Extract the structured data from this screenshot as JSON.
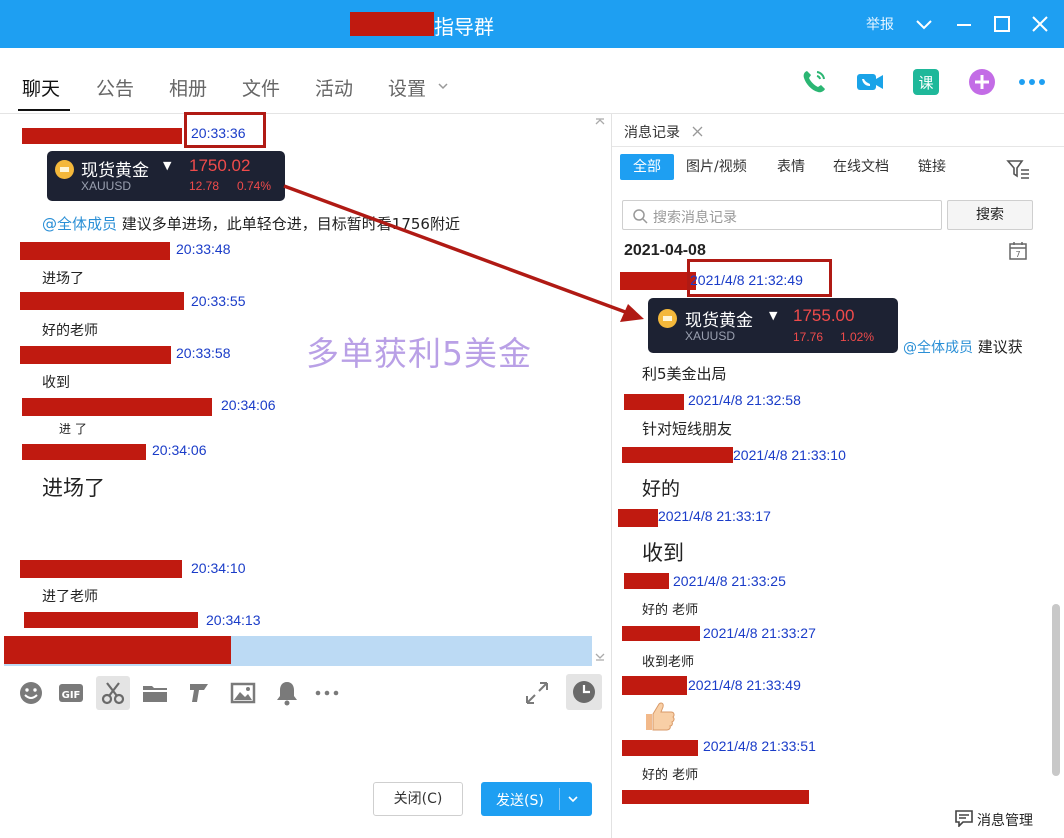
{
  "window": {
    "title": "指导群",
    "report_label": "举报"
  },
  "tabs": [
    {
      "label": "聊天"
    },
    {
      "label": "公告"
    },
    {
      "label": "相册"
    },
    {
      "label": "文件"
    },
    {
      "label": "活动"
    },
    {
      "label": "设置"
    }
  ],
  "colors": {
    "titlebar": "#1e9ff2",
    "redaction": "#c01a10",
    "timestamp": "#1a3cc8",
    "mention": "#2a8fd6",
    "card_bg": "#1d2233",
    "price_up": "#ef4b4b"
  },
  "chat": {
    "watermark": "多单获利5美金",
    "gold_card": {
      "name": "现货黄金",
      "symbol": "XAUUSD",
      "price": "1750.02",
      "change": "12.78",
      "percent": "0.74%"
    },
    "mention": "@全体成员",
    "mention_text": "建议多单进场，此单轻仓进，目标暂时看1756附近",
    "messages": [
      {
        "time": "20:33:36"
      },
      {
        "time": "20:33:48",
        "text": "进场了"
      },
      {
        "time": "20:33:55",
        "text": "好的老师"
      },
      {
        "time": "20:33:58",
        "text": "收到"
      },
      {
        "time": "20:34:06",
        "text": "进 了"
      },
      {
        "time": "20:34:06",
        "text": "进场了"
      },
      {
        "time": "20:34:10",
        "text": "进了老师"
      },
      {
        "time": "20:34:13"
      }
    ]
  },
  "input": {
    "close_label": "关闭(C)",
    "send_label": "发送(S)"
  },
  "history": {
    "tab_label": "消息记录",
    "filters": [
      "全部",
      "图片/视频",
      "表情",
      "在线文档",
      "链接"
    ],
    "search_placeholder": "搜索消息记录",
    "search_button": "搜索",
    "date": "2021-04-08",
    "gold_card": {
      "name": "现货黄金",
      "symbol": "XAUUSD",
      "price": "1755.00",
      "change": "17.76",
      "percent": "1.02%"
    },
    "mention": "@全体成员",
    "mention_text": "建议获",
    "mention_text_cont": "利5美金出局",
    "messages": [
      {
        "time": "2021/4/8 21:32:49"
      },
      {
        "time": "2021/4/8 21:32:58",
        "text": "针对短线朋友"
      },
      {
        "time": "2021/4/8 21:33:10",
        "text": "好的"
      },
      {
        "time": "2021/4/8 21:33:17",
        "text": "收到"
      },
      {
        "time": "2021/4/8 21:33:25",
        "text": "好的  老师"
      },
      {
        "time": "2021/4/8 21:33:27",
        "text": "收到老师"
      },
      {
        "time": "2021/4/8 21:33:49"
      },
      {
        "time": "2021/4/8 21:33:51",
        "text": "好的  老师"
      }
    ],
    "manage_label": "消息管理"
  }
}
